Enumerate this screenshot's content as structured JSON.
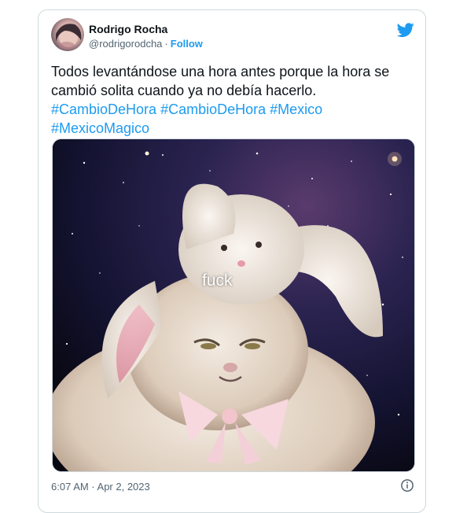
{
  "tweet": {
    "author_name": "Rodrigo Rocha",
    "handle": "@rodrigorodcha",
    "separator": "·",
    "follow_label": "Follow",
    "text_line1": "Todos levantándose una hora antes porque la hora se",
    "text_line2": "cambió solita cuando ya no debía hacerlo.",
    "hashtags_line1": [
      "#CambioDeHora",
      "#CambioDeHora",
      "#Mexico"
    ],
    "hashtags_line2": [
      "#MexicoMagico"
    ],
    "image_caption": "fuck",
    "timestamp": "6:07 AM · Apr 2, 2023"
  },
  "icons": {
    "brand": "twitter-bird-icon",
    "info": "info-icon"
  },
  "colors": {
    "accent": "#1d9bf0",
    "text": "#0f1419",
    "muted": "#536471",
    "border": "#cfd9de"
  }
}
